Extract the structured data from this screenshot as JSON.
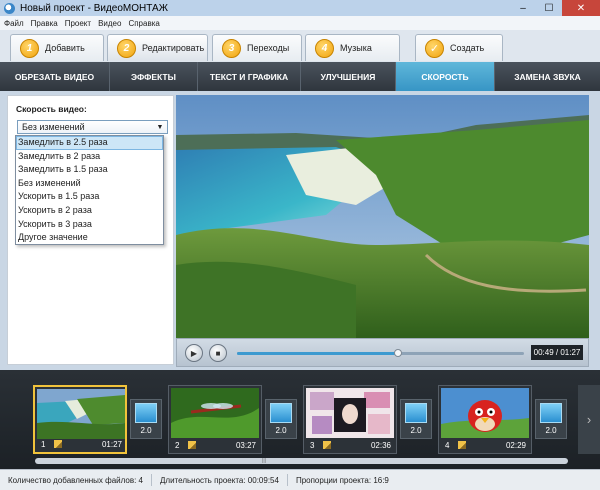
{
  "window": {
    "title": "Новый проект - ВидеоМОНТАЖ",
    "buttons": [
      "–",
      "☐",
      "✕"
    ]
  },
  "menu": [
    "Файл",
    "Правка",
    "Проект",
    "Видео",
    "Справка"
  ],
  "steps": [
    {
      "num": "1",
      "label": "Добавить"
    },
    {
      "num": "2",
      "label": "Редактировать",
      "active": true
    },
    {
      "num": "3",
      "label": "Переходы"
    },
    {
      "num": "4",
      "label": "Музыка"
    },
    {
      "num": "✓",
      "label": "Создать"
    }
  ],
  "tabs": [
    {
      "label": "ОБРЕЗАТЬ ВИДЕО"
    },
    {
      "label": "ЭФФЕКТЫ"
    },
    {
      "label": "ТЕКСТ И ГРАФИКА"
    },
    {
      "label": "УЛУЧШЕНИЯ"
    },
    {
      "label": "СКОРОСТЬ",
      "active": true
    },
    {
      "label": "ЗАМЕНА ЗВУКА"
    }
  ],
  "speed_panel": {
    "caption": "Скорость видео:",
    "selected": "Без изменений",
    "options": [
      "Замедлить в 2.5 раза",
      "Замедлить в 2 раза",
      "Замедлить в 1.5 раза",
      "Без изменений",
      "Ускорить в 1.5 раза",
      "Ускорить в 2 раза",
      "Ускорить в 3 раза",
      "Другое значение"
    ],
    "highlighted_index": 0
  },
  "player": {
    "time": "00:49 / 01:27",
    "progress": 0.56,
    "play_icon": "▶",
    "stop_icon": "■"
  },
  "timeline": {
    "clips": [
      {
        "num": "1",
        "duration": "01:27",
        "selected": true,
        "thumb": "island-coast"
      },
      {
        "num": "2",
        "duration": "03:27",
        "thumb": "dragonfly-leaf"
      },
      {
        "num": "3",
        "duration": "02:36",
        "thumb": "girl-collage"
      },
      {
        "num": "4",
        "duration": "02:29",
        "thumb": "angry-bird"
      }
    ],
    "transitions": [
      "2.0",
      "2.0",
      "2.0",
      "2.0"
    ],
    "next_icon": "›",
    "scroll_grip": "|||"
  },
  "status": {
    "files": "Количество добавленных файлов: 4",
    "duration": "Длительность проекта:  00:09:54",
    "ratio": "Пропорции проекта:  16:9"
  },
  "colors": {
    "accent": "#3795c5",
    "tab_bar": "#353c43",
    "timeline_bg": "#22282d",
    "step_badge": "#f1a30c"
  }
}
